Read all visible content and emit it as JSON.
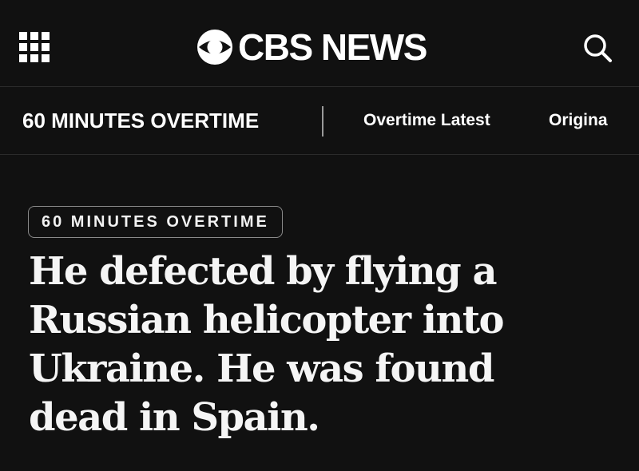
{
  "header": {
    "brand_name": "CBS NEWS",
    "icons": {
      "menu": "grid-menu-icon",
      "logo": "cbs-eye-icon",
      "search": "search-icon"
    }
  },
  "subnav": {
    "section_title": "60 MINUTES OVERTIME",
    "links": [
      {
        "label": "Overtime Latest"
      },
      {
        "label": "Origina"
      }
    ]
  },
  "article": {
    "category_badge": "60 MINUTES OVERTIME",
    "headline": "He defected by flying a Russian helicopter into Ukraine. He was found dead in Spain."
  },
  "colors": {
    "background": "#111111",
    "text": "#ffffff",
    "divider": "#2b2b2b"
  }
}
